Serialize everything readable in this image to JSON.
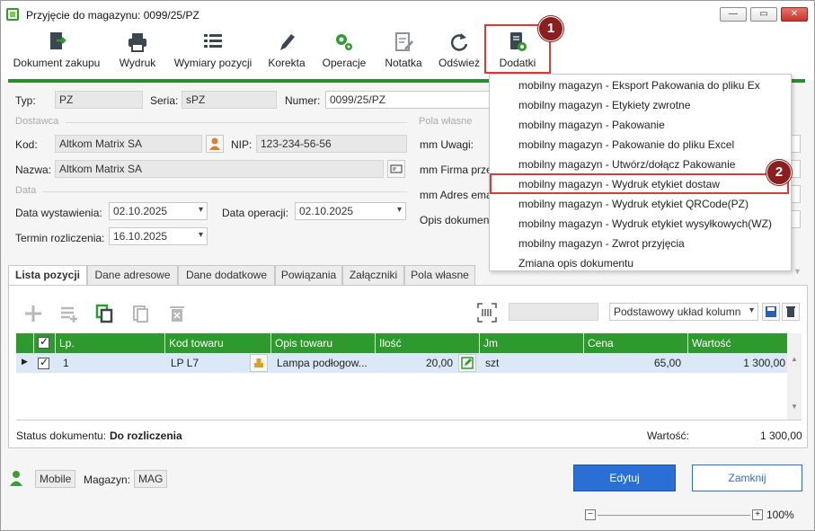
{
  "window": {
    "title": "Przyjęcie do magazynu: 0099/25/PZ"
  },
  "toolbar": {
    "items": [
      {
        "label": "Dokument zakupu"
      },
      {
        "label": "Wydruk"
      },
      {
        "label": "Wymiary pozycji"
      },
      {
        "label": "Korekta"
      },
      {
        "label": "Operacje"
      },
      {
        "label": "Notatka"
      },
      {
        "label": "Odśwież"
      },
      {
        "label": "Dodatki"
      }
    ]
  },
  "annotations": {
    "badge1": "1",
    "badge2": "2"
  },
  "header": {
    "typ_label": "Typ:",
    "typ_value": "PZ",
    "seria_label": "Seria:",
    "seria_value": "sPZ",
    "numer_label": "Numer:",
    "numer_value": "0099/25/PZ"
  },
  "dostawca": {
    "section": "Dostawca",
    "kod_label": "Kod:",
    "kod_value": "Altkom Matrix SA",
    "nip_label": "NIP:",
    "nip_value": "123-234-56-56",
    "nazwa_label": "Nazwa:",
    "nazwa_value": "Altkom Matrix SA"
  },
  "data": {
    "section": "Data",
    "wystawienia_label": "Data wystawienia:",
    "wystawienia_value": "02.10.2025",
    "operacji_label": "Data operacji:",
    "operacji_value": "02.10.2025",
    "termin_label": "Termin rozliczenia:",
    "termin_value": "16.10.2025"
  },
  "pola_wlasne": {
    "section": "Pola własne",
    "f1": "mm Uwagi:",
    "f2": "mm Firma prze",
    "f3": "mm Adres ema",
    "f4": "Opis dokumen"
  },
  "menu": {
    "items": [
      "mobilny magazyn - Eksport Pakowania do pliku Ex",
      "mobilny magazyn - Etykiety zwrotne",
      "mobilny magazyn - Pakowanie",
      "mobilny magazyn - Pakowanie do pliku Excel",
      "mobilny magazyn - Utwórz/dołącz Pakowanie",
      "mobilny magazyn - Wydruk etykiet dostaw",
      "mobilny magazyn - Wydruk etykiet QRCode(PZ)",
      "mobilny magazyn - Wydruk etykiet wysyłkowych(WZ)",
      "mobilny magazyn - Zwrot przyjęcia",
      "Zmiana opis dokumentu"
    ]
  },
  "tabs": [
    "Lista pozycji",
    "Dane adresowe",
    "Dane dodatkowe",
    "Powiązania",
    "Załączniki",
    "Pola własne"
  ],
  "grid": {
    "layout_select": "Podstawowy układ kolumn",
    "columns": [
      "Lp.",
      "Kod towaru",
      "Opis towaru",
      "Ilość",
      "Jm",
      "Cena",
      "Wartość"
    ],
    "rows": [
      {
        "lp": "1",
        "kod": "LP L7",
        "opis": "Lampa  podłogow...",
        "ilosc": "20,00",
        "jm": "szt",
        "cena": "65,00",
        "wartosc": "1 300,00"
      }
    ]
  },
  "status": {
    "label": "Status dokumentu:",
    "value": "Do rozliczenia",
    "wartosc_label": "Wartość:",
    "wartosc_value": "1 300,00"
  },
  "footer": {
    "mobile": "Mobile",
    "magazyn_label": "Magazyn:",
    "magazyn_value": "MAG",
    "edytuj": "Edytuj",
    "zamknij": "Zamknij",
    "zoom": "100%"
  }
}
